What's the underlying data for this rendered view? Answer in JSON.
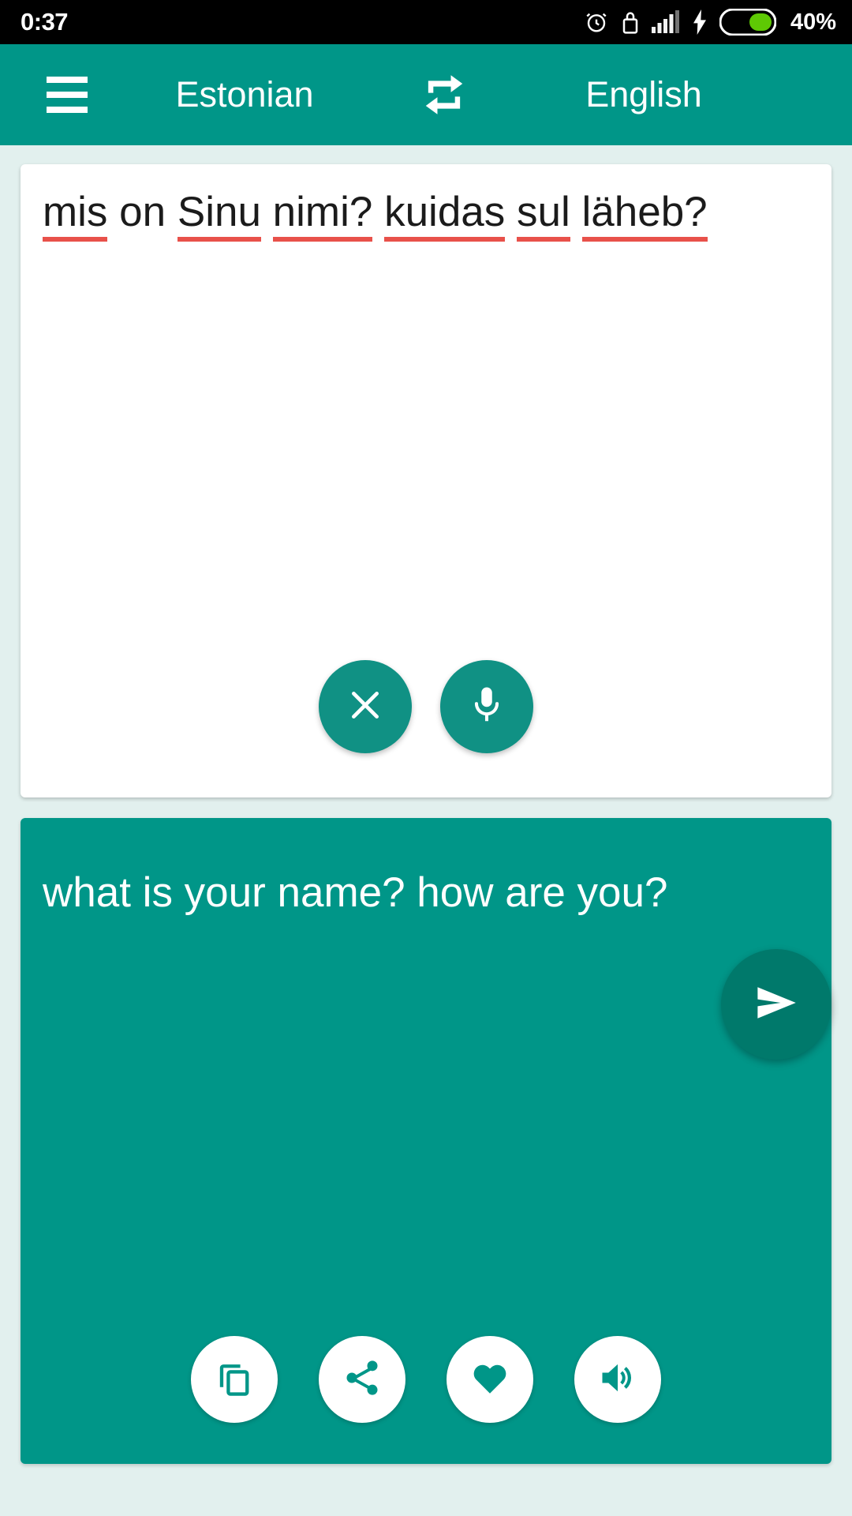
{
  "statusbar": {
    "clock": "0:37",
    "battery_percent": "40%",
    "icons": [
      "alarm-icon",
      "lock-icon",
      "signal-icon",
      "charging-bolt-icon",
      "battery-icon"
    ]
  },
  "appbar": {
    "menu_icon": "hamburger-menu-icon",
    "source_language": "Estonian",
    "swap_icon": "swap-languages-icon",
    "target_language": "English"
  },
  "input_card": {
    "text": "mis on Sinu nimi? kuidas sul läheb?",
    "tokens": [
      {
        "word": "mis",
        "misspelled": true
      },
      {
        "word": "on",
        "misspelled": false
      },
      {
        "word": "Sinu",
        "misspelled": true
      },
      {
        "word": "nimi?",
        "misspelled": true
      },
      {
        "word": "kuidas",
        "misspelled": true
      },
      {
        "word": "sul",
        "misspelled": true
      },
      {
        "word": "läheb?",
        "misspelled": true
      }
    ],
    "clear_icon": "close-x-icon",
    "mic_icon": "microphone-icon"
  },
  "send_button": {
    "icon": "send-icon"
  },
  "output_card": {
    "text": "what is your name? how are you?",
    "actions": [
      {
        "icon": "copy-icon",
        "name": "copy-button"
      },
      {
        "icon": "share-icon",
        "name": "share-button"
      },
      {
        "icon": "heart-icon",
        "name": "favorite-button"
      },
      {
        "icon": "speaker-icon",
        "name": "speak-button"
      }
    ]
  },
  "colors": {
    "accent": "#009688",
    "accent_dark": "#00796b",
    "page_background": "#e2f0ee",
    "misspell_underline": "#e8514a",
    "battery_fill": "#5ec904"
  }
}
